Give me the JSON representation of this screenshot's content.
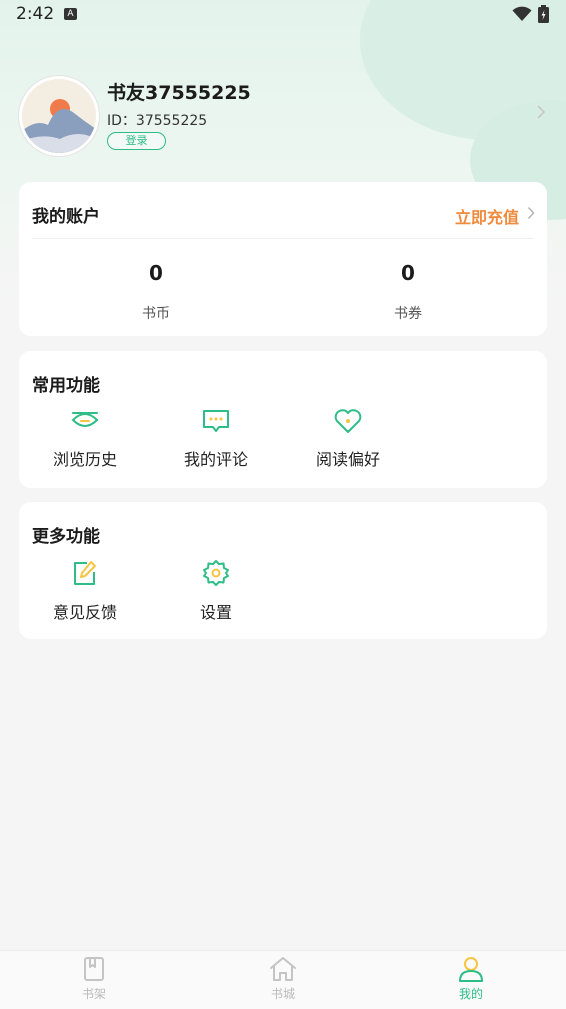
{
  "status_bar": {
    "time": "2:42",
    "indicator": "A"
  },
  "profile": {
    "username": "书友37555225",
    "id_text": "ID：37555225",
    "login_label": "登录"
  },
  "account": {
    "title": "我的账户",
    "recharge_label": "立即充值",
    "stats": [
      {
        "value": "0",
        "label": "书币"
      },
      {
        "value": "0",
        "label": "书券"
      }
    ]
  },
  "common_functions": {
    "title": "常用功能",
    "items": [
      {
        "label": "浏览历史",
        "icon": "eye-icon"
      },
      {
        "label": "我的评论",
        "icon": "comment-icon"
      },
      {
        "label": "阅读偏好",
        "icon": "heart-icon"
      }
    ]
  },
  "more_functions": {
    "title": "更多功能",
    "items": [
      {
        "label": "意见反馈",
        "icon": "feedback-edit-icon"
      },
      {
        "label": "设置",
        "icon": "gear-icon"
      }
    ]
  },
  "tabbar": {
    "items": [
      {
        "label": "书架",
        "icon": "bookshelf-icon",
        "active": false
      },
      {
        "label": "书城",
        "icon": "home-icon",
        "active": false
      },
      {
        "label": "我的",
        "icon": "person-icon",
        "active": true
      }
    ]
  },
  "colors": {
    "accent": "#2ebd86",
    "recharge": "#f08a3c",
    "icon_yellow": "#f5c542"
  }
}
